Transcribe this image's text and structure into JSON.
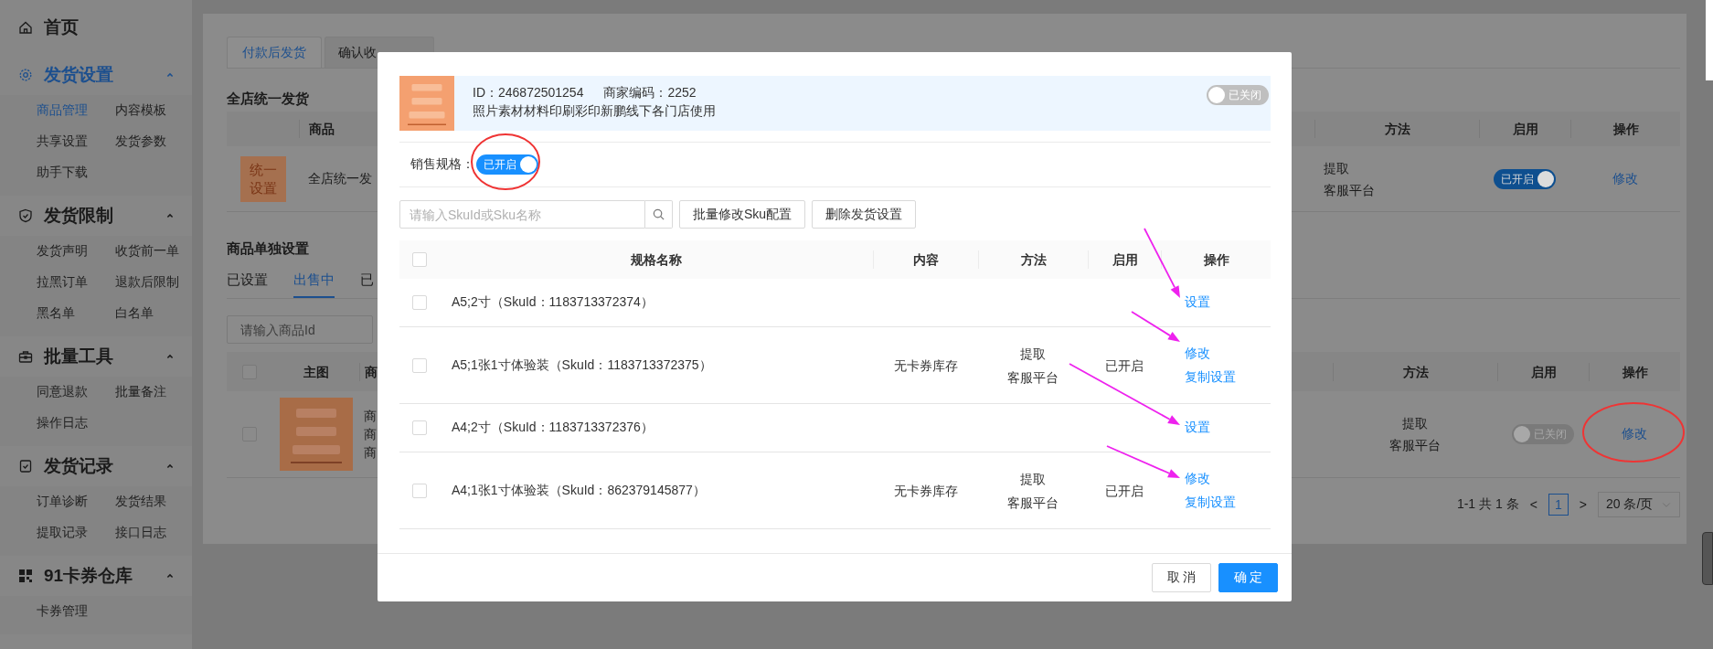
{
  "sidebar": {
    "home": {
      "label": "首页"
    },
    "groups": [
      {
        "title": "发货设置",
        "selected": true,
        "expanded": true,
        "items": [
          {
            "label": "商品管理",
            "selected": true
          },
          {
            "label": "内容模板",
            "selected": false
          },
          {
            "label": "共享设置",
            "selected": false
          },
          {
            "label": "发货参数",
            "selected": false
          },
          {
            "label": "助手下载",
            "selected": false
          }
        ]
      },
      {
        "title": "发货限制",
        "selected": false,
        "expanded": true,
        "items": [
          {
            "label": "发货声明",
            "selected": false
          },
          {
            "label": "收货前一单",
            "selected": false
          },
          {
            "label": "拉黑订单",
            "selected": false
          },
          {
            "label": "退款后限制",
            "selected": false
          },
          {
            "label": "黑名单",
            "selected": false
          },
          {
            "label": "白名单",
            "selected": false
          }
        ]
      },
      {
        "title": "批量工具",
        "selected": false,
        "expanded": true,
        "items": [
          {
            "label": "同意退款",
            "selected": false
          },
          {
            "label": "批量备注",
            "selected": false
          },
          {
            "label": "操作日志",
            "selected": false
          }
        ]
      },
      {
        "title": "发货记录",
        "selected": false,
        "expanded": true,
        "items": [
          {
            "label": "订单诊断",
            "selected": false
          },
          {
            "label": "发货结果",
            "selected": false
          },
          {
            "label": "提取记录",
            "selected": false
          },
          {
            "label": "接口日志",
            "selected": false
          }
        ]
      },
      {
        "title": "91卡券仓库",
        "selected": false,
        "expanded": true,
        "items": [
          {
            "label": "卡券管理",
            "selected": false
          }
        ]
      }
    ]
  },
  "main": {
    "tabs": [
      {
        "label": "付款后发货",
        "selected": true
      },
      {
        "label": "确认收",
        "selected": false
      }
    ],
    "unified": {
      "title": "全店统一发货",
      "columns": [
        "商品",
        "方法",
        "启用",
        "操作"
      ],
      "row": {
        "badge": [
          "统一",
          "设置"
        ],
        "name": "全店统一发",
        "method": [
          "提取",
          "客服平台"
        ],
        "toggle": {
          "on": true,
          "label": "已开启"
        },
        "action": "修改"
      }
    },
    "single": {
      "title": "商品单独设置",
      "tabs": [
        {
          "label": "已设置",
          "selected": false
        },
        {
          "label": "出售中",
          "selected": true
        },
        {
          "label": "已",
          "selected": false
        }
      ],
      "search": {
        "placeholder": "请输入商品Id"
      },
      "header_checked": false,
      "columns": [
        "主图",
        "商",
        "方法",
        "启用",
        "操作"
      ],
      "row": {
        "checked": false,
        "image": {
          "kind": "picture"
        },
        "name_lines": [
          "商",
          "商",
          "商"
        ],
        "method": [
          "提取",
          "客服平台"
        ],
        "toggle": {
          "on": false,
          "label": "已关闭"
        },
        "action": "修改"
      },
      "pagination": {
        "summary": "1-1 共 1 条",
        "prev": "<",
        "pages": [
          {
            "label": "1",
            "selected": true
          }
        ],
        "next": ">",
        "page_size": "20 条/页"
      }
    }
  },
  "modal": {
    "product": {
      "image": {
        "kind": "picture"
      },
      "id": "ID：246872501254",
      "code": "商家编码：2252",
      "title": "照片素材材料印刷彩印新鹏线下各门店使用",
      "toggle": {
        "on": false,
        "label": "已关闭"
      }
    },
    "sale_spec": {
      "label": "销售规格：",
      "toggle": {
        "on": true,
        "label": "已开启"
      }
    },
    "search": {
      "placeholder": "请输入SkuId或Sku名称"
    },
    "buttons": [
      "批量修改Sku配置",
      "删除发货设置"
    ],
    "table": {
      "header_checked": false,
      "columns": [
        "规格名称",
        "内容",
        "方法",
        "启用",
        "操作"
      ],
      "rows": [
        {
          "checked": false,
          "name": "A5;2寸（SkuId：1183713372374）",
          "actions": [
            "设置"
          ]
        },
        {
          "checked": false,
          "name": "A5;1张1寸体验装（SkuId：1183713372375）",
          "content": "无卡券库存",
          "method": [
            "提取",
            "客服平台"
          ],
          "enabled": "已开启",
          "actions": [
            "修改",
            "复制设置"
          ]
        },
        {
          "checked": false,
          "name": "A4;2寸（SkuId：1183713372376）",
          "actions": [
            "设置"
          ]
        },
        {
          "checked": false,
          "name": "A4;1张1寸体验装（SkuId：862379145877）",
          "content": "无卡券库存",
          "method": [
            "提取",
            "客服平台"
          ],
          "enabled": "已开启",
          "actions": [
            "修改",
            "复制设置"
          ]
        }
      ]
    },
    "footer": [
      {
        "label": "取 消",
        "kind": "default"
      },
      {
        "label": "确 定",
        "kind": "primary"
      }
    ]
  },
  "annotations": [
    {
      "kind": "circle"
    },
    {
      "kind": "circle"
    },
    {
      "kind": "arrow"
    },
    {
      "kind": "arrow"
    },
    {
      "kind": "arrow"
    },
    {
      "kind": "arrow"
    }
  ]
}
